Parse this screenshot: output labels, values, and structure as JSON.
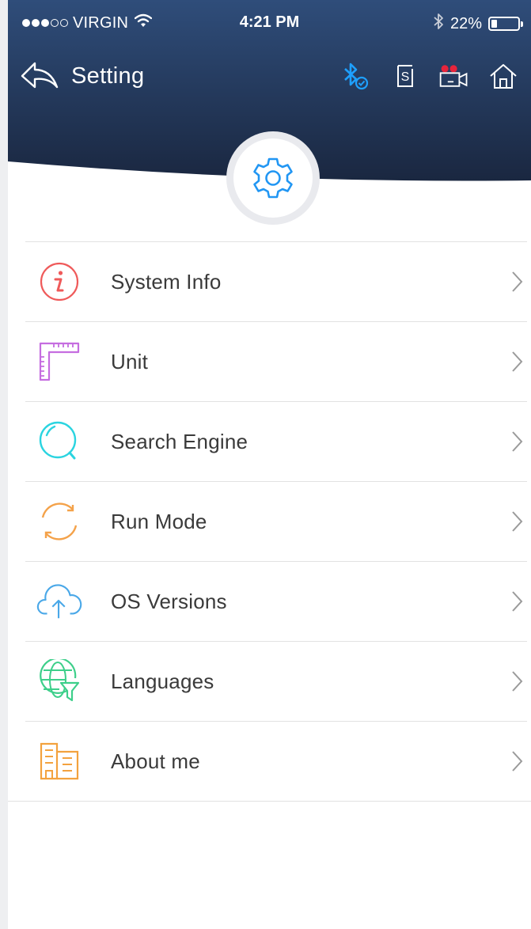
{
  "status_bar": {
    "signal_dots": [
      true,
      true,
      true,
      false,
      false
    ],
    "carrier": "VIRGIN",
    "time": "4:21 PM",
    "battery_percent": "22%",
    "battery_level": 0.22,
    "icons": [
      "wifi-icon",
      "bluetooth-icon",
      "battery-icon"
    ]
  },
  "nav": {
    "title": "Setting",
    "actions": [
      "bluetooth-connected-icon",
      "s-card-icon",
      "video-camera-icon",
      "home-icon"
    ]
  },
  "header_icon": "gear-icon",
  "menu": {
    "items": [
      {
        "label": "System Info",
        "icon": "info-icon",
        "color": "#ef5a5a"
      },
      {
        "label": "Unit",
        "icon": "ruler-icon",
        "color": "#c56de0"
      },
      {
        "label": "Search Engine",
        "icon": "search-icon",
        "color": "#2bd4e0"
      },
      {
        "label": "Run Mode",
        "icon": "refresh-icon",
        "color": "#f4a24a"
      },
      {
        "label": "OS Versions",
        "icon": "cloud-upload-icon",
        "color": "#4aa8e8"
      },
      {
        "label": "Languages",
        "icon": "globe-filter-icon",
        "color": "#3dcf8a"
      },
      {
        "label": "About me",
        "icon": "building-icon",
        "color": "#f3a23e"
      }
    ]
  },
  "colors": {
    "header_top": "#2f4d7a",
    "header_bottom": "#1a2740",
    "accent_blue": "#1ea0ff",
    "gear_blue": "#2196f3",
    "camera_red": "#e8243b"
  }
}
